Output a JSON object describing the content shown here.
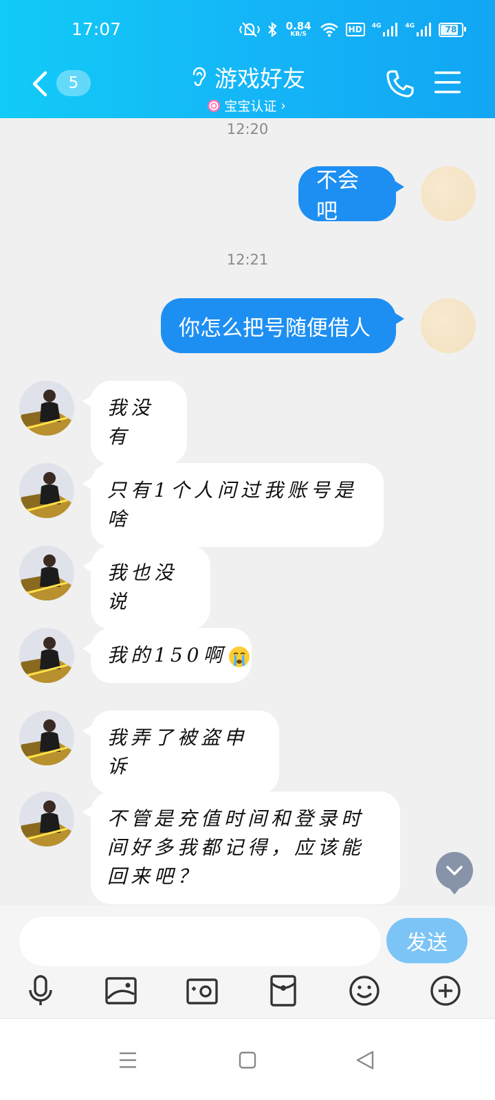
{
  "status_bar": {
    "time": "17:07",
    "net_speed_value": "0.84",
    "net_speed_unit": "KB/S",
    "hd_label": "HD",
    "sim1_label": "4G",
    "sim2_label": "4G",
    "battery_level": "78"
  },
  "header": {
    "unread_count": "5",
    "title": "游戏好友",
    "subtitle": "宝宝认证",
    "subtitle_chevron": "›",
    "icons": [
      "back-icon",
      "ear-icon",
      "candy-icon",
      "phone-icon",
      "menu-icon"
    ]
  },
  "messages": [
    {
      "type": "time",
      "text": "12:20"
    },
    {
      "type": "out",
      "text": "不会吧"
    },
    {
      "type": "time",
      "text": "12:21"
    },
    {
      "type": "out",
      "text": "你怎么把号随便借人"
    },
    {
      "type": "in",
      "text": "我没有"
    },
    {
      "type": "in",
      "text": "只有1个人问过我账号是啥"
    },
    {
      "type": "in",
      "text": "我也没说"
    },
    {
      "type": "in",
      "text": "我的150啊",
      "emoji": "crying-face"
    },
    {
      "type": "in",
      "text": "我弄了被盗申诉"
    },
    {
      "type": "in",
      "text": "不管是充值时间和登录时间好多我都记得，应该能回来吧？"
    }
  ],
  "input": {
    "value": "",
    "placeholder": "",
    "send_label": "发送"
  },
  "toolbar": [
    "microphone-icon",
    "image-icon",
    "camera-icon",
    "red-packet-icon",
    "emoji-icon",
    "plus-icon"
  ],
  "nav": [
    "recent-apps-icon",
    "home-icon",
    "back-triangle-icon"
  ],
  "colors": {
    "header_gradient_start": "#12cbf7",
    "header_gradient_end": "#12a6f3",
    "outgoing_bubble": "#1e8ff2",
    "incoming_bubble": "#ffffff",
    "chat_background": "#f0f0f0",
    "send_button": "#7cc4f6"
  }
}
